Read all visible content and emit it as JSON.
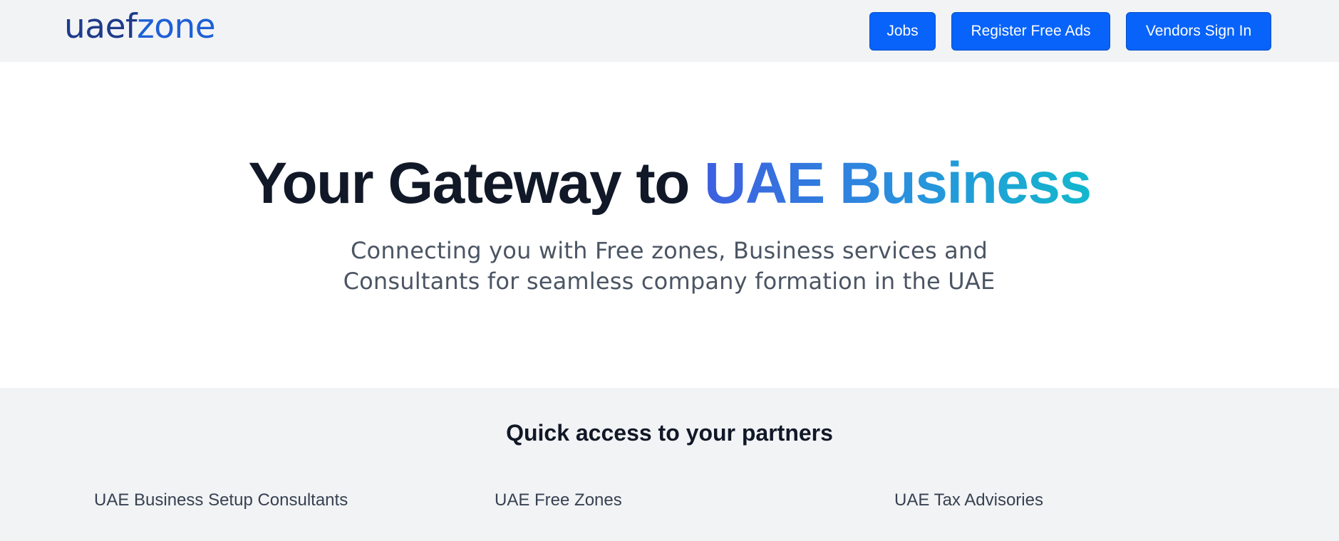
{
  "header": {
    "logo_part_a": "uaef",
    "logo_part_b": "zone",
    "nav": {
      "jobs_label": "Jobs",
      "register_label": "Register Free Ads",
      "vendors_label": "Vendors Sign In"
    },
    "background_color": "#f2f3f5",
    "button_color": "#0763fa"
  },
  "hero": {
    "title_plain": "Your Gateway to ",
    "title_highlight": "UAE Business",
    "subtitle_line_1": "Connecting you with Free zones, Business services and",
    "subtitle_line_2": "Consultants for seamless company formation in the UAE",
    "highlight_gradient": [
      "#3d5fe0",
      "#2a8fde",
      "#12b8cc"
    ]
  },
  "partners": {
    "title": "Quick access to your partners",
    "links": [
      {
        "label": "UAE Business Setup Consultants"
      },
      {
        "label": "UAE Free Zones"
      },
      {
        "label": "UAE Tax Advisories"
      }
    ]
  }
}
